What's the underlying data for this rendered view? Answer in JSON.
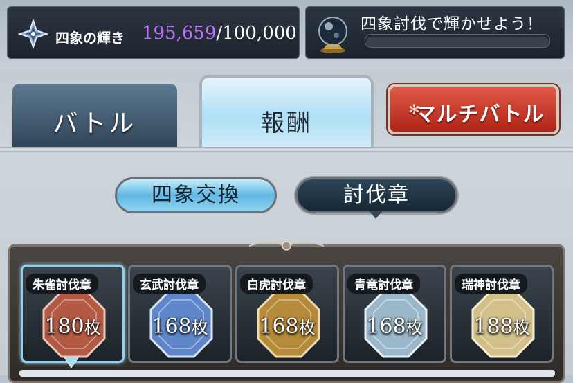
{
  "resource": {
    "label": "四象の輝き",
    "current": "195,659",
    "separator": "/",
    "max": "100,000",
    "current_color": "#c070ff"
  },
  "quest": {
    "text": "四象討伐で輝かせよう！",
    "progress": 0.0
  },
  "tabs": [
    {
      "label": "バトル",
      "active": false
    },
    {
      "label": "報酬",
      "active": true
    },
    {
      "label": "マルチバトル",
      "active": false
    }
  ],
  "subtabs": [
    {
      "label": "四象交換",
      "active": false
    },
    {
      "label": "討伐章",
      "active": true
    }
  ],
  "badges": [
    {
      "label": "朱雀討伐章",
      "count": "180",
      "unit": "枚",
      "color": "#b35a44",
      "selected": true
    },
    {
      "label": "玄武討伐章",
      "count": "168",
      "unit": "枚",
      "color": "#5f86c9",
      "selected": false
    },
    {
      "label": "白虎討伐章",
      "count": "168",
      "unit": "枚",
      "color": "#b58a3b",
      "selected": false
    },
    {
      "label": "青竜討伐章",
      "count": "168",
      "unit": "枚",
      "color": "#9ab8c9",
      "selected": false
    },
    {
      "label": "瑞神討伐章",
      "count": "188",
      "unit": "枚",
      "color": "#d2c08a",
      "selected": false
    }
  ],
  "icons": {
    "resource": "star-crystal-icon",
    "quest": "crystal-orb-icon",
    "selection": "diamond-pointer-icon"
  }
}
